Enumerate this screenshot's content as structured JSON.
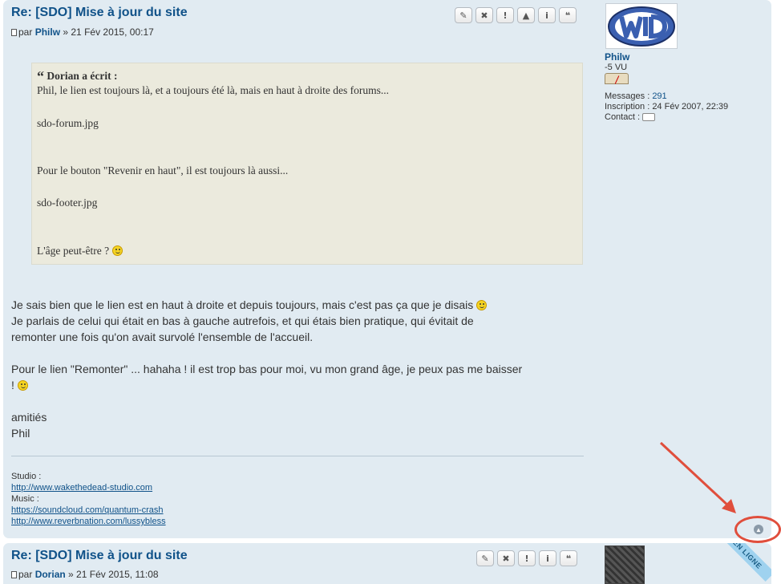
{
  "post1": {
    "title": "Re: [SDO] Mise à jour du site",
    "meta_prefix": "par",
    "author": "Philw",
    "date": "» 21 Fév 2015, 00:17",
    "buttons": [
      "✎",
      "✖",
      "!",
      "▲",
      "i",
      "❝"
    ],
    "quote": {
      "cite": "Dorian a écrit :",
      "lines": [
        "Phil, le lien est toujours là, et a toujours été là, mais en haut à droite des forums...",
        "sdo-forum.jpg",
        "Pour le bouton \"Revenir en haut\", il est toujours là aussi...",
        "sdo-footer.jpg",
        "L'âge peut-être ?"
      ]
    },
    "body": {
      "line1": "Je sais bien que le lien est en haut à droite et depuis toujours, mais c'est pas ça que je disais",
      "line2": "Je parlais de celui qui était en bas à gauche autrefois, et qui étais bien pratique, qui évitait de",
      "line3": "remonter une fois qu'on avait survolé l'ensemble de l'accueil.",
      "line4": "Pour le lien \"Remonter\" ... hahaha ! il est trop bas pour moi, vu mon grand âge, je peux pas me baisser",
      "line5": "!",
      "line6": "amitiés",
      "line7": "Phil"
    },
    "signature": {
      "studio_label": "Studio :",
      "studio_url": "http://www.wakethedead-studio.com",
      "music_label": "Music :",
      "music_url1": "https://soundcloud.com/quantum-crash",
      "music_url2": "http://www.reverbnation.com/lussybless"
    },
    "profile": {
      "username": "Philw",
      "rank": "-5 VU",
      "messages_label": "Messages :",
      "messages_value": "291",
      "inscription_label": "Inscription :",
      "inscription_value": "24 Fév 2007, 22:39",
      "contact_label": "Contact :"
    }
  },
  "post2": {
    "title": "Re: [SDO] Mise à jour du site",
    "meta_prefix": "par",
    "author": "Dorian",
    "date": "» 21 Fév 2015, 11:08",
    "buttons": [
      "✎",
      "✖",
      "!",
      "i",
      "❝"
    ],
    "online_badge": "EN LIGNE"
  },
  "top_link_icon": "up-arrow-circle-icon",
  "colors": {
    "accent": "#105289",
    "post_bg": "#e1ebf2",
    "quote_bg": "#ebeadd",
    "annotation": "#e04e3c"
  }
}
